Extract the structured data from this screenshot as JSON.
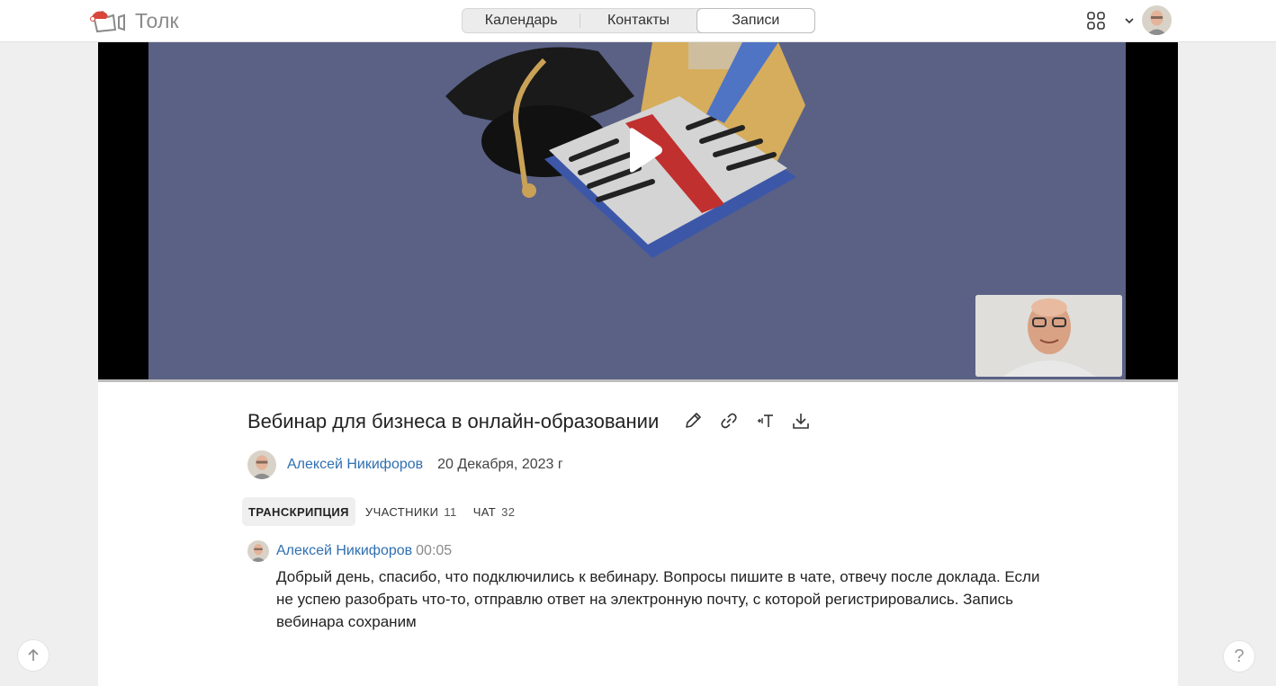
{
  "app": {
    "name": "Толк"
  },
  "nav": {
    "tabs": [
      {
        "label": "Календарь",
        "active": false
      },
      {
        "label": "Контакты",
        "active": false
      },
      {
        "label": "Записи",
        "active": true
      }
    ]
  },
  "header_icons": [
    "apps-grid-icon",
    "chevron-down-icon",
    "user-avatar"
  ],
  "recording": {
    "title": "Вебинар для бизнеса в онлайн-образовании",
    "author": "Алексей Никифоров",
    "date": "20 Декабря, 2023 г",
    "actions": [
      "pencil-icon",
      "link-icon",
      "text-size-icon",
      "download-icon"
    ]
  },
  "subtabs": [
    {
      "label": "ТРАНСКРИПЦИЯ",
      "count": "",
      "active": true
    },
    {
      "label": "УЧАСТНИКИ",
      "count": "11",
      "active": false
    },
    {
      "label": "ЧАТ",
      "count": "32",
      "active": false
    }
  ],
  "transcript": [
    {
      "author": "Алексей Никифоров",
      "time": "00:05",
      "text": "Добрый день, спасибо, что подключились к вебинару. Вопросы пишите в чате, отвечу после доклада. Если не успею разобрать что-то, отправлю ответ на электронную почту, с которой регистрировались. Запись вебинара сохраним"
    }
  ],
  "fab": {
    "help": "?"
  },
  "colors": {
    "accent_link": "#2f6fb1",
    "video_bg": "#5a6185"
  }
}
